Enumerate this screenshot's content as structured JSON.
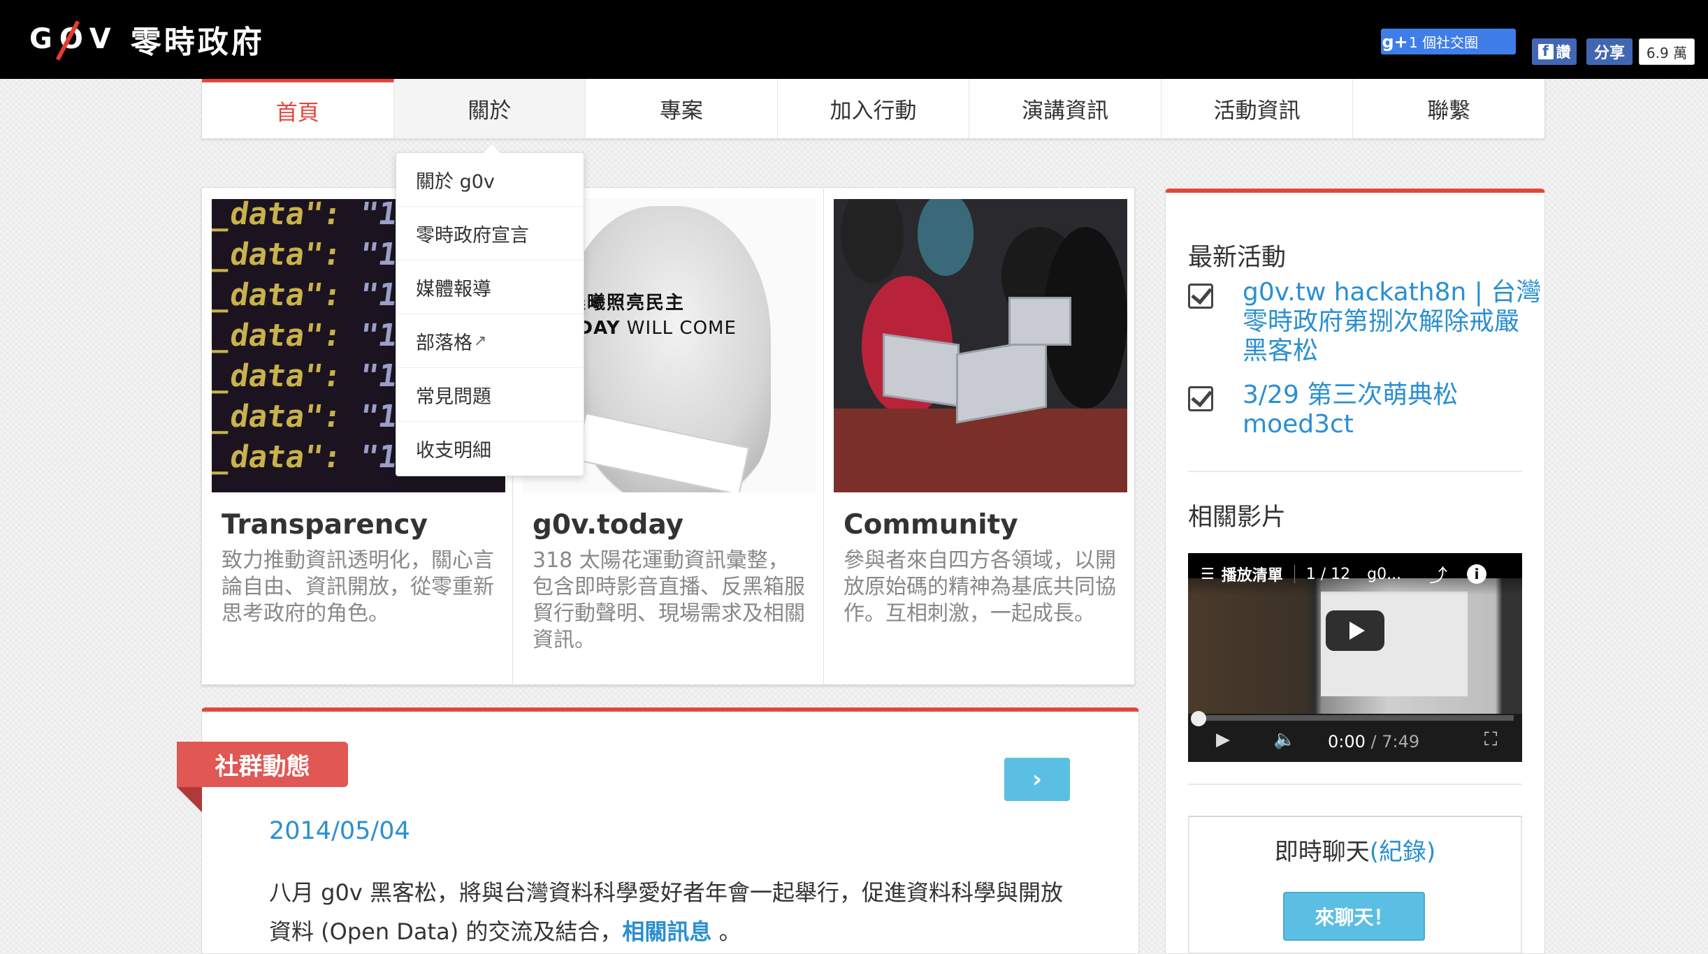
{
  "header": {
    "logo_mark": "GOV",
    "logo_text": "零時政府",
    "gplus_label": "1 個社交圈",
    "fb_like_label": "讚",
    "fb_share_label": "分享",
    "fb_count": "6.9 萬"
  },
  "nav": {
    "items": [
      {
        "label": "首頁",
        "active": true
      },
      {
        "label": "關於",
        "active": false
      },
      {
        "label": "專案",
        "active": false
      },
      {
        "label": "加入行動",
        "active": false
      },
      {
        "label": "演講資訊",
        "active": false
      },
      {
        "label": "活動資訊",
        "active": false
      },
      {
        "label": "聯繫",
        "active": false
      }
    ]
  },
  "dropdown": {
    "items": [
      {
        "label": "關於 g0v"
      },
      {
        "label": "零時政府宣言"
      },
      {
        "label": "媒體報導"
      },
      {
        "label": "部落格",
        "external": true
      },
      {
        "label": "常見問題"
      },
      {
        "label": "收支明細"
      }
    ]
  },
  "features": [
    {
      "title": "Transparency",
      "desc": "致力推動資訊透明化，關心言論自由、資訊開放，從零重新思考政府的角色。",
      "image": {
        "code_key": "_data\":",
        "code_value": "\"1020808;\\"
      }
    },
    {
      "title": "g0v.today",
      "desc": "318 太陽花運動資訊彙整，包含即時影音直播、反黑箱服貿行動聲明、現場需求及相關資訊。",
      "image": {
        "line1_bold": "讓晨曦",
        "line1_rest": "照亮民主",
        "line2_bold": "EW DAY",
        "line2_rest": " WILL COME"
      }
    },
    {
      "title": "Community",
      "desc": "參與者來自四方各領域，以開放原始碼的精神為基底共同協作。互相刺激，一起成長。"
    }
  ],
  "community": {
    "ribbon_label": "社群動態",
    "next_icon": "chevron-right-icon",
    "date": "2014/05/04",
    "text_before": "八月 g0v 黑客松，將與台灣資料科學愛好者年會一起舉行，促進資料科學與開放資料 (Open Data) 的交流及結合，",
    "link_text": "相關訊息",
    "text_after": " 。"
  },
  "sidebar": {
    "events_heading": "最新活動",
    "events": [
      {
        "label": "g0v.tw hackath8n | 台灣零時政府第捌次解除戒嚴黑客松"
      },
      {
        "label": "3/29 第三次萌典松 moed3ct"
      }
    ],
    "video_heading": "相關影片",
    "video": {
      "playlist_label": "播放清單",
      "position": "1 / 12",
      "title": "g0...",
      "current_time": "0:00",
      "duration": "/ 7:49"
    },
    "chat_title": "即時聊天",
    "chat_log": "(紀錄)",
    "chat_button": "來聊天！"
  },
  "colors": {
    "accent_red": "#e3473b",
    "link_blue": "#2a8fd0",
    "button_blue": "#5bbfe3"
  }
}
